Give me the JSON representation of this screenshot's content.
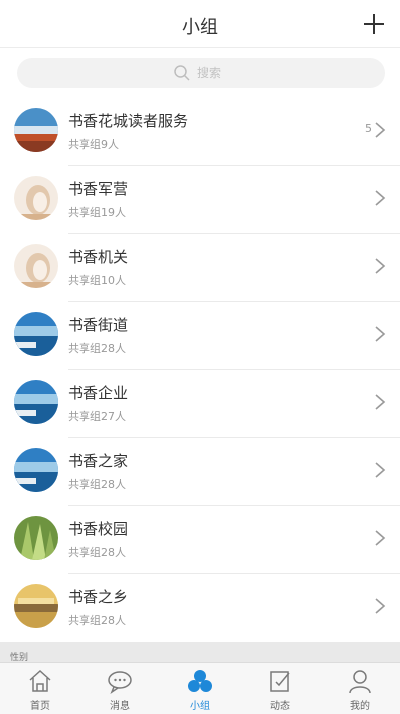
{
  "header": {
    "title": "小组"
  },
  "search": {
    "placeholder": "搜索"
  },
  "groups": [
    {
      "name": "书香花城读者服务",
      "members": "共享组9人",
      "badge": "5"
    },
    {
      "name": "书香军营",
      "members": "共享组19人",
      "badge": ""
    },
    {
      "name": "书香机关",
      "members": "共享组10人",
      "badge": ""
    },
    {
      "name": "书香街道",
      "members": "共享组28人",
      "badge": ""
    },
    {
      "name": "书香企业",
      "members": "共享组27人",
      "badge": ""
    },
    {
      "name": "书香之家",
      "members": "共享组28人",
      "badge": ""
    },
    {
      "name": "书香校园",
      "members": "共享组28人",
      "badge": ""
    },
    {
      "name": "书香之乡",
      "members": "共享组28人",
      "badge": ""
    }
  ],
  "strip": {
    "text": "性别"
  },
  "tabs": [
    {
      "label": "首页",
      "icon": "home-icon"
    },
    {
      "label": "消息",
      "icon": "message-icon"
    },
    {
      "label": "小组",
      "icon": "group-icon"
    },
    {
      "label": "动态",
      "icon": "edit-icon"
    },
    {
      "label": "我的",
      "icon": "profile-icon"
    }
  ],
  "colors": {
    "accent": "#1e88d8",
    "tab_inactive": "#666666"
  }
}
